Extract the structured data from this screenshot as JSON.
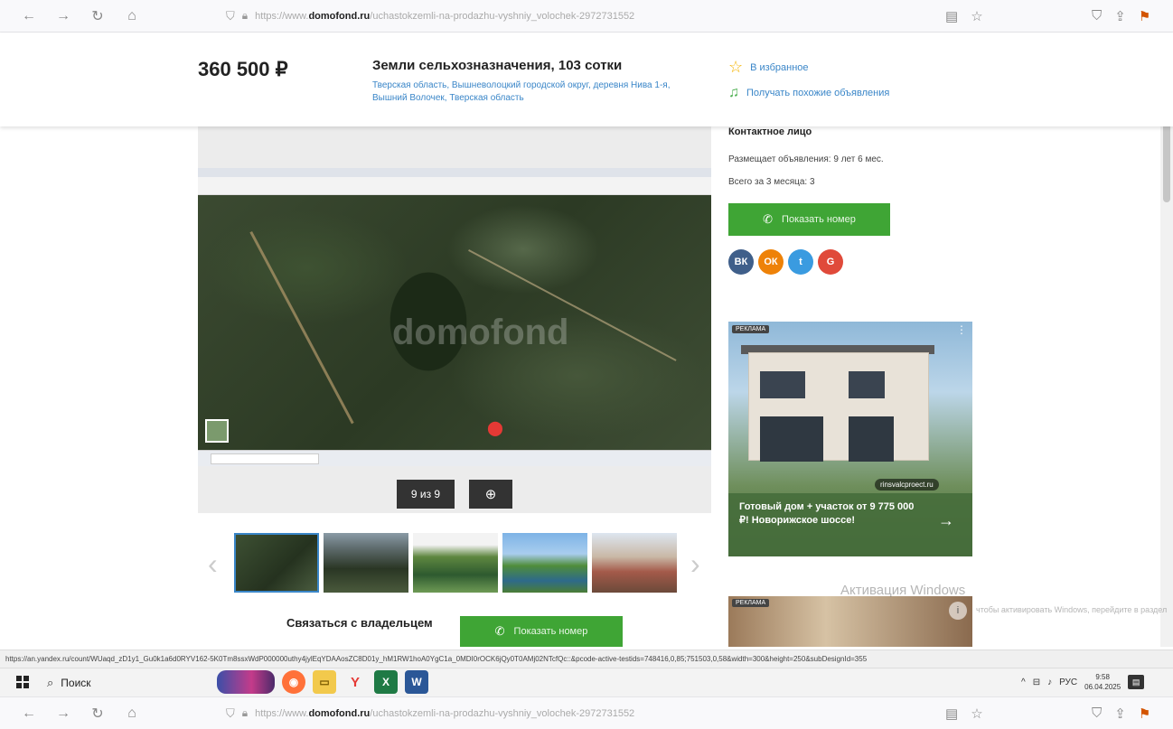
{
  "browser": {
    "url_prefix": "https://www.",
    "url_domain": "domofond.ru",
    "url_path": "/uchastokzemli-na-prodazhu-vyshniy_volochek-2972731552"
  },
  "header": {
    "price": "360 500 ₽",
    "title": "Земли сельхозназначения, 103 сотки",
    "address": "Тверская область, Вышневолоцкий городской округ, деревня Нива 1-я, Вышний Волочек, Тверская область",
    "favorite_label": "В избранное",
    "similar_label": "Получать похожие объявления"
  },
  "gallery": {
    "watermark": "domofond",
    "counter": "9 из 9",
    "zoom_icon": "search-plus-icon"
  },
  "contact": {
    "title": "Контактное лицо",
    "posting_since": "Размещает объявления: 9 лет 6 мес.",
    "total_3m": "Всего за 3 месяца: 3",
    "show_phone": "Показать номер",
    "social": [
      "ВК",
      "ОК",
      "t",
      "G"
    ]
  },
  "ad1": {
    "badge": "РЕКЛАМА",
    "site": "rinsvalcproect.ru",
    "text": "Готовый дом + участок от 9 775 000 ₽! Новорижское шоссе!"
  },
  "ad2": {
    "badge": "РЕКЛАМА"
  },
  "contact_owner": {
    "label": "Связаться с владельцем",
    "show_phone": "Показать номер"
  },
  "watermark_windows": {
    "title": "Активация Windows",
    "subtitle": "чтобы активировать Windows, перейдите в раздел"
  },
  "status_url": "https://an.yandex.ru/count/WUaqd_zD1y1_Gu0k1a6d0RYV162-5K0Tm8ssxWdP000000uthy4jylEqYDAAosZC8D01y_hM1RW1hoA0YgC1a_0MDI0rOCK6jQy0T0AMj02NTcfQc::&pcode-active-testids=748416,0,85;751503,0,58&width=300&height=250&subDesignId=355",
  "taskbar": {
    "search_placeholder": "Поиск",
    "lang": "РУС",
    "time": "9:58",
    "date": "06.04.2025"
  }
}
